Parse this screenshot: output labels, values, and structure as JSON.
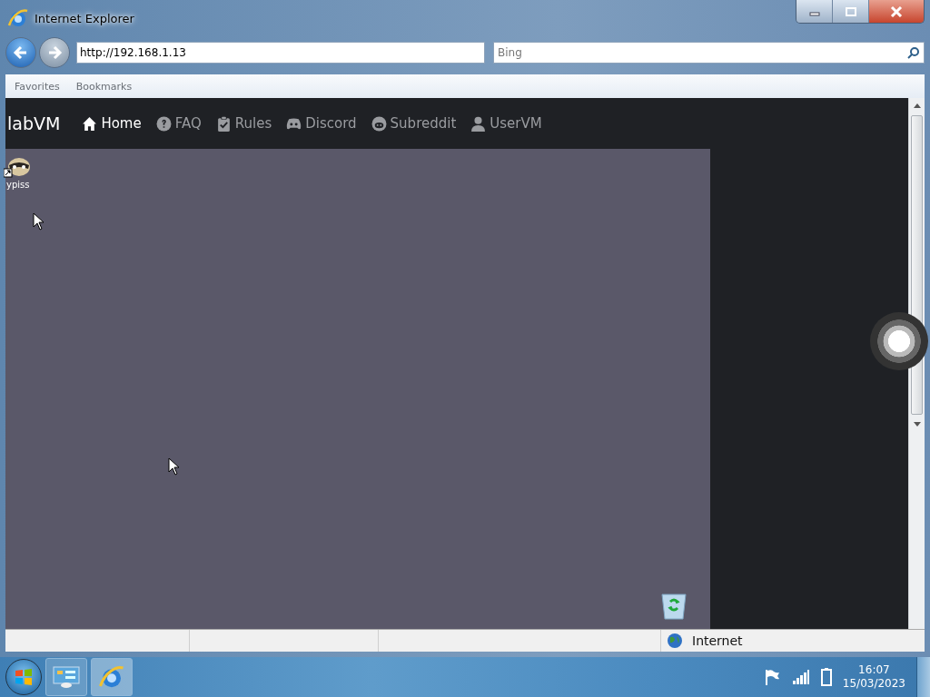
{
  "window": {
    "title": "Internet Explorer"
  },
  "address_bar": {
    "value": "http://192.168.1.13"
  },
  "search": {
    "placeholder": "Bing"
  },
  "favorites_bar": [
    "Favorites",
    "Bookmarks"
  ],
  "site": {
    "brand": "labVM",
    "nav": [
      {
        "label": "Home",
        "selected": true
      },
      {
        "label": "FAQ",
        "selected": false
      },
      {
        "label": "Rules",
        "selected": false
      },
      {
        "label": "Discord",
        "selected": false
      },
      {
        "label": "Subreddit",
        "selected": false
      },
      {
        "label": "UserVM",
        "selected": false
      }
    ]
  },
  "vm_desktop": {
    "icons": [
      {
        "kind": "shortcut",
        "label": "ypiss"
      },
      {
        "kind": "recycle-bin"
      }
    ]
  },
  "status_bar": {
    "zone": "Internet"
  },
  "taskbar": {
    "time": "16:07",
    "date": "15/03/2023"
  }
}
